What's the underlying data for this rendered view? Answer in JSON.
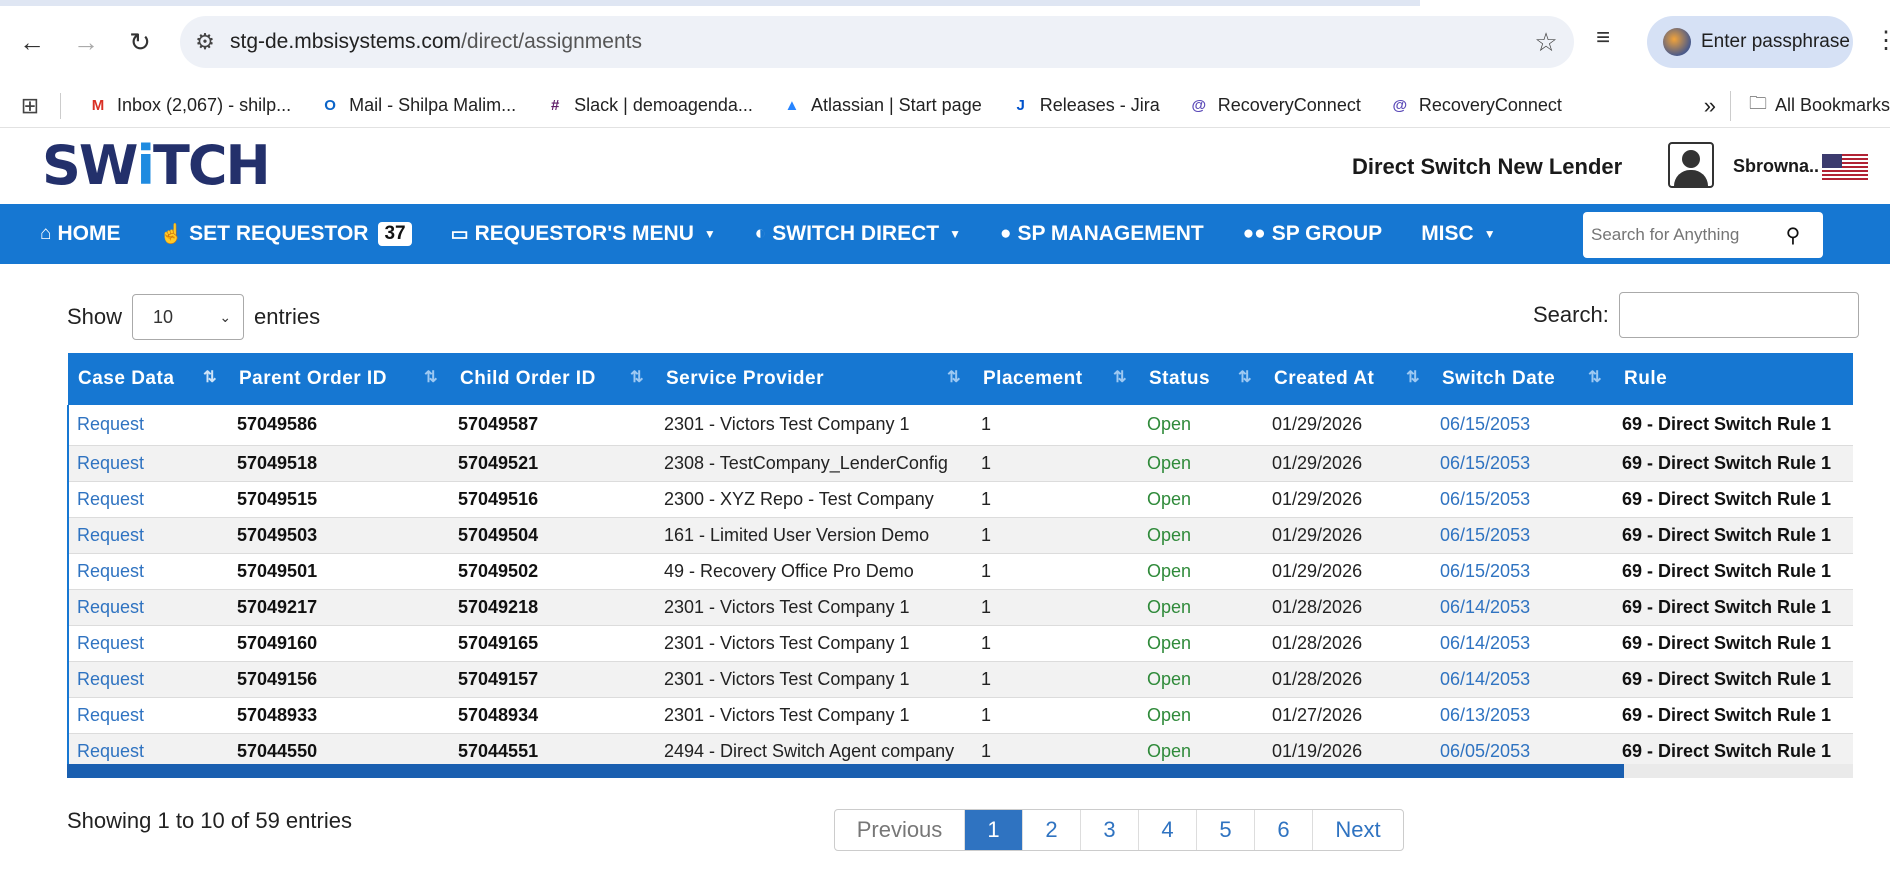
{
  "browser": {
    "url_host": "stg-de.mbsisystems.com",
    "url_path": "/direct/assignments",
    "profile_label": "Enter passphrase",
    "bookmarks": [
      {
        "label": "Inbox (2,067) - shilp...",
        "icon": "gmail-icon",
        "color": "#d93025",
        "glyph": "M"
      },
      {
        "label": "Mail - Shilpa Malim...",
        "icon": "outlook-icon",
        "color": "#0a64c8",
        "glyph": "O"
      },
      {
        "label": "Slack | demoagenda...",
        "icon": "slack-icon",
        "color": "#611f69",
        "glyph": "#"
      },
      {
        "label": "Atlassian | Start page",
        "icon": "atlassian-icon",
        "color": "#2684ff",
        "glyph": "▲"
      },
      {
        "label": "Releases - Jira",
        "icon": "jira-icon",
        "color": "#0052cc",
        "glyph": "J"
      },
      {
        "label": "RecoveryConnect",
        "icon": "recoveryconnect-icon",
        "color": "#5b4ab8",
        "glyph": "@"
      },
      {
        "label": "RecoveryConnect",
        "icon": "recoveryconnect-icon",
        "color": "#5b4ab8",
        "glyph": "@"
      }
    ],
    "all_bookmarks_label": "All Bookmarks"
  },
  "header": {
    "logo_text_before": "SW",
    "logo_text_i": "i",
    "logo_text_after": "TCH",
    "title": "Direct Switch New Lender",
    "username": "Sbrowna.."
  },
  "nav": {
    "home": "HOME",
    "set_requestor": "SET REQUESTOR",
    "set_requestor_count": "37",
    "requestors_menu": "REQUESTOR'S MENU",
    "switch_direct": "SWITCH DIRECT",
    "sp_management": "SP MANAGEMENT",
    "sp_group": "SP GROUP",
    "misc": "MISC",
    "search_placeholder": "Search for Anything"
  },
  "controls": {
    "show_label": "Show",
    "entries_value": "10",
    "entries_label": "entries",
    "search_label": "Search:"
  },
  "table": {
    "columns": [
      "Case Data",
      "Parent Order ID",
      "Child Order ID",
      "Service Provider",
      "Placement",
      "Status",
      "Created At",
      "Switch Date",
      "Rule"
    ],
    "rows": [
      {
        "case": "Request",
        "parent": "57049586",
        "child": "57049587",
        "provider": "2301 - Victors Test Company 1",
        "placement": "1",
        "status": "Open",
        "created": "01/29/2026",
        "switch": "06/15/2053",
        "rule": "69 - Direct Switch Rule 1"
      },
      {
        "case": "Request",
        "parent": "57049518",
        "child": "57049521",
        "provider": "2308 - TestCompany_LenderConfig",
        "placement": "1",
        "status": "Open",
        "created": "01/29/2026",
        "switch": "06/15/2053",
        "rule": "69 - Direct Switch Rule 1"
      },
      {
        "case": "Request",
        "parent": "57049515",
        "child": "57049516",
        "provider": "2300 - XYZ Repo - Test Company",
        "placement": "1",
        "status": "Open",
        "created": "01/29/2026",
        "switch": "06/15/2053",
        "rule": "69 - Direct Switch Rule 1"
      },
      {
        "case": "Request",
        "parent": "57049503",
        "child": "57049504",
        "provider": "161 - Limited User Version Demo",
        "placement": "1",
        "status": "Open",
        "created": "01/29/2026",
        "switch": "06/15/2053",
        "rule": "69 - Direct Switch Rule 1"
      },
      {
        "case": "Request",
        "parent": "57049501",
        "child": "57049502",
        "provider": "49 - Recovery Office Pro Demo",
        "placement": "1",
        "status": "Open",
        "created": "01/29/2026",
        "switch": "06/15/2053",
        "rule": "69 - Direct Switch Rule 1"
      },
      {
        "case": "Request",
        "parent": "57049217",
        "child": "57049218",
        "provider": "2301 - Victors Test Company 1",
        "placement": "1",
        "status": "Open",
        "created": "01/28/2026",
        "switch": "06/14/2053",
        "rule": "69 - Direct Switch Rule 1"
      },
      {
        "case": "Request",
        "parent": "57049160",
        "child": "57049165",
        "provider": "2301 - Victors Test Company 1",
        "placement": "1",
        "status": "Open",
        "created": "01/28/2026",
        "switch": "06/14/2053",
        "rule": "69 - Direct Switch Rule 1"
      },
      {
        "case": "Request",
        "parent": "57049156",
        "child": "57049157",
        "provider": "2301 - Victors Test Company 1",
        "placement": "1",
        "status": "Open",
        "created": "01/28/2026",
        "switch": "06/14/2053",
        "rule": "69 - Direct Switch Rule 1"
      },
      {
        "case": "Request",
        "parent": "57048933",
        "child": "57048934",
        "provider": "2301 - Victors Test Company 1",
        "placement": "1",
        "status": "Open",
        "created": "01/27/2026",
        "switch": "06/13/2053",
        "rule": "69 - Direct Switch Rule 1"
      },
      {
        "case": "Request",
        "parent": "57044550",
        "child": "57044551",
        "provider": "2494 - Direct Switch Agent company",
        "placement": "1",
        "status": "Open",
        "created": "01/19/2026",
        "switch": "06/05/2053",
        "rule": "69 - Direct Switch Rule 1"
      }
    ]
  },
  "footer": {
    "info": "Showing 1 to 10 of 59 entries",
    "prev_label": "Previous",
    "pages": [
      "1",
      "2",
      "3",
      "4",
      "5",
      "6"
    ],
    "current_page": "1",
    "next_label": "Next"
  },
  "colors": {
    "nav_blue": "#1677d2",
    "link_blue": "#2f73c1",
    "status_open_green": "#2f8a3a",
    "logo_navy": "#23306b"
  }
}
